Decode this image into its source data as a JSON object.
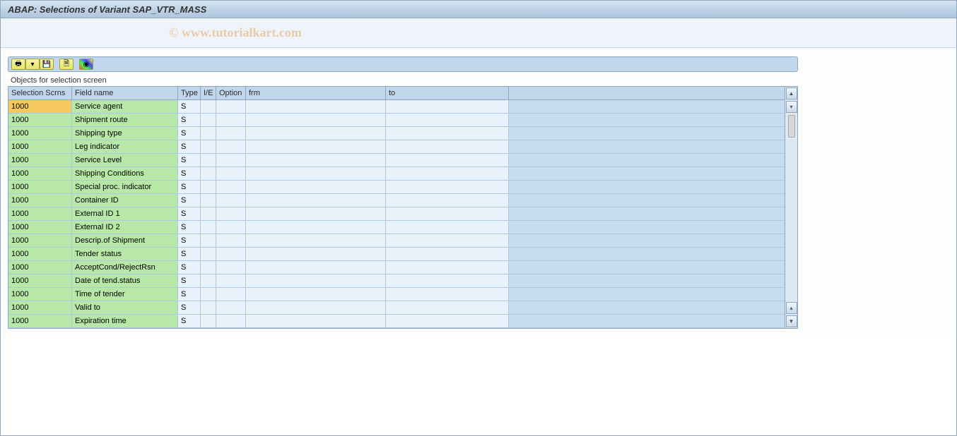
{
  "title": "ABAP: Selections of Variant SAP_VTR_MASS",
  "watermark": "© www.tutorialkart.com",
  "toolbar": {
    "icons": [
      "print-icon",
      "filter-icon",
      "save-icon",
      "page-icon",
      "color-icon"
    ]
  },
  "section_label": "Objects for selection screen",
  "columns": {
    "scrns": "Selection Scrns",
    "field": "Field name",
    "type": "Type",
    "ie": "I/E",
    "option": "Option",
    "frm": "frm",
    "to": "to"
  },
  "rows": [
    {
      "scrn": "1000",
      "field": "Service agent",
      "type": "S",
      "selected": true
    },
    {
      "scrn": "1000",
      "field": "Shipment route",
      "type": "S"
    },
    {
      "scrn": "1000",
      "field": "Shipping type",
      "type": "S"
    },
    {
      "scrn": "1000",
      "field": "Leg indicator",
      "type": "S"
    },
    {
      "scrn": "1000",
      "field": "Service Level",
      "type": "S"
    },
    {
      "scrn": "1000",
      "field": "Shipping Conditions",
      "type": "S"
    },
    {
      "scrn": "1000",
      "field": "Special proc. indicator",
      "type": "S"
    },
    {
      "scrn": "1000",
      "field": "Container ID",
      "type": "S"
    },
    {
      "scrn": "1000",
      "field": "External ID 1",
      "type": "S"
    },
    {
      "scrn": "1000",
      "field": "External ID 2",
      "type": "S"
    },
    {
      "scrn": "1000",
      "field": "Descrip.of Shipment",
      "type": "S"
    },
    {
      "scrn": "1000",
      "field": "Tender status",
      "type": "S"
    },
    {
      "scrn": "1000",
      "field": "AcceptCond/RejectRsn",
      "type": "S"
    },
    {
      "scrn": "1000",
      "field": "Date of tend.status",
      "type": "S"
    },
    {
      "scrn": "1000",
      "field": "Time of tender",
      "type": "S"
    },
    {
      "scrn": "1000",
      "field": "Valid to",
      "type": "S"
    },
    {
      "scrn": "1000",
      "field": "Expiration time",
      "type": "S"
    }
  ]
}
